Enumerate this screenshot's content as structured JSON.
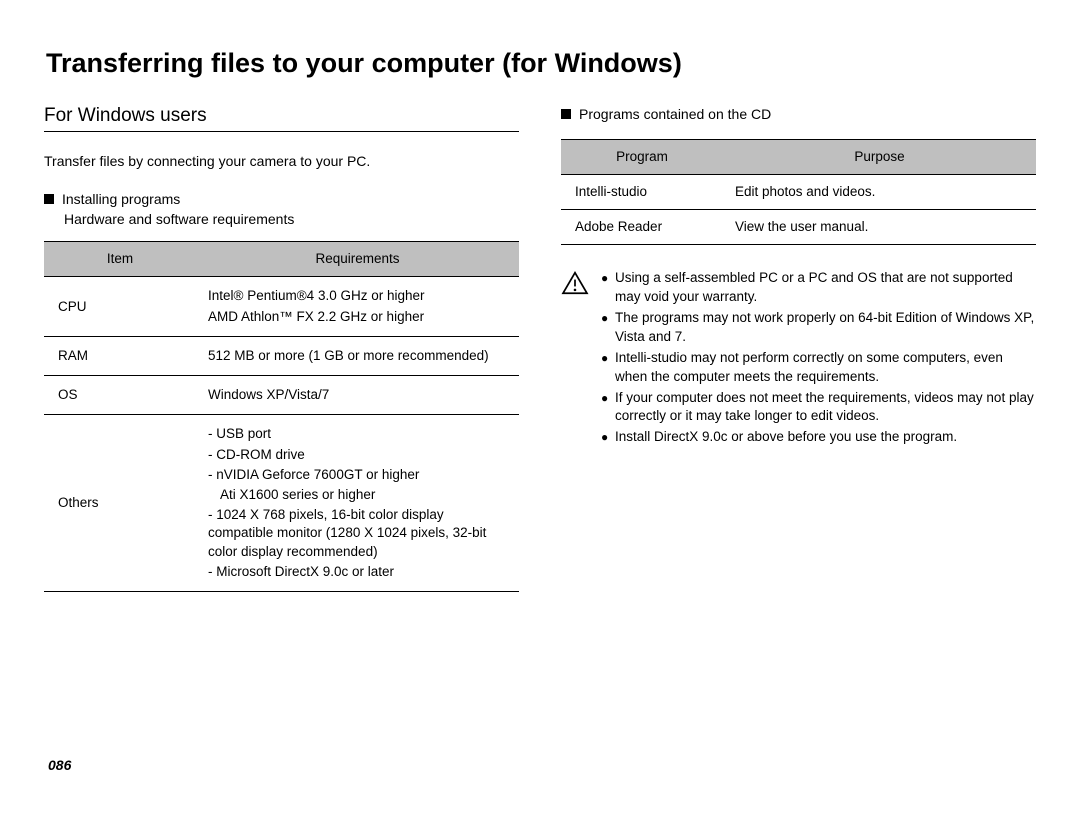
{
  "title": "Transferring files to your computer (for Windows)",
  "page_number": "086",
  "left": {
    "section_heading": "For Windows users",
    "intro": "Transfer files by connecting your camera to your PC.",
    "sub1_title": "Installing programs",
    "sub1_secondary": "Hardware and software requirements",
    "table1": {
      "headers": [
        "Item",
        "Requirements"
      ],
      "rows": [
        {
          "item": "CPU",
          "lines": [
            "Intel® Pentium®4 3.0 GHz or higher",
            "AMD Athlon™ FX 2.2 GHz or higher"
          ]
        },
        {
          "item": "RAM",
          "lines": [
            "512 MB or more (1 GB or more recommended)"
          ]
        },
        {
          "item": "OS",
          "lines": [
            "Windows XP/Vista/7"
          ]
        },
        {
          "item": "Others",
          "lines": [
            "- USB port",
            "- CD-ROM drive",
            "- nVIDIA Geforce 7600GT or higher",
            "Ati X1600 series or higher",
            "- 1024 X 768 pixels, 16-bit color display compatible monitor (1280 X 1024 pixels, 32-bit color display recommended)",
            "- Microsoft DirectX 9.0c or later"
          ],
          "indent_idx": [
            3
          ]
        }
      ]
    }
  },
  "right": {
    "sub_title": "Programs contained on the CD",
    "table2": {
      "headers": [
        "Program",
        "Purpose"
      ],
      "rows": [
        {
          "program": "Intelli-studio",
          "purpose": "Edit photos and videos."
        },
        {
          "program": "Adobe Reader",
          "purpose": "View the user manual."
        }
      ]
    },
    "warnings": [
      "Using a self-assembled PC or a PC and OS that are not supported may void your warranty.",
      "The programs may not work properly on 64-bit Edition of Windows XP, Vista and 7.",
      "Intelli-studio may not perform correctly on some computers, even when the computer meets the requirements.",
      "If your computer does not meet the requirements, videos may not play correctly or it may take longer to edit videos.",
      "Install DirectX 9.0c or above before you use the program."
    ]
  }
}
